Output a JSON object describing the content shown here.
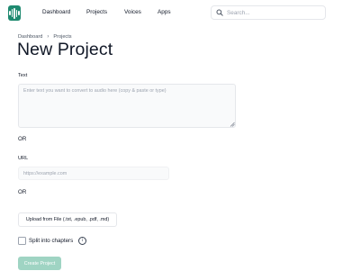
{
  "nav": {
    "logo_icon": "waveform-logo-icon",
    "brand_color": "#1f8a70",
    "items": [
      {
        "label": "Dashboard"
      },
      {
        "label": "Projects"
      },
      {
        "label": "Voices"
      },
      {
        "label": "Apps"
      }
    ],
    "search": {
      "placeholder": "Search...",
      "icon": "search-icon"
    }
  },
  "breadcrumb": {
    "items": [
      "Dashboard",
      "Projects"
    ],
    "separator": "›"
  },
  "page": {
    "title": "New Project"
  },
  "form": {
    "text_label": "Text",
    "text_placeholder": "Enter text you want to convert to audio here (copy & paste or type)",
    "or_1": "OR",
    "url_label": "URL",
    "url_placeholder": "https://example.com",
    "or_2": "OR",
    "upload_label": "Upload from File (.txt, .epub, .pdf, .md)",
    "split_label": "Split into chapters",
    "split_checked": false,
    "info_icon": "i",
    "create_label": "Create Project",
    "create_color": "#9fd4c3",
    "create_disabled": true
  }
}
